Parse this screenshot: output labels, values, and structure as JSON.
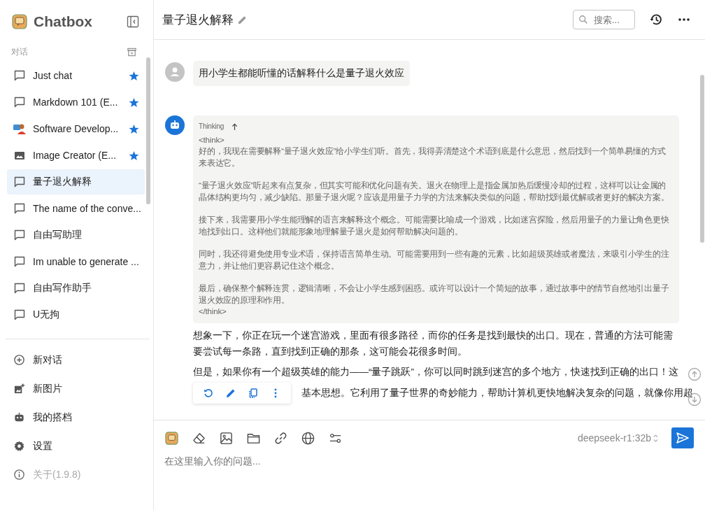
{
  "sidebar": {
    "app_name": "Chatbox",
    "section_label": "对话",
    "conversations": [
      {
        "title": "Just chat",
        "kind": "chat",
        "starred": true,
        "selected": false
      },
      {
        "title": "Markdown 101 (E...",
        "kind": "chat",
        "starred": true,
        "selected": false
      },
      {
        "title": "Software Develop...",
        "kind": "avatar",
        "starred": true,
        "selected": false
      },
      {
        "title": "Image Creator (E...",
        "kind": "image",
        "starred": true,
        "selected": false
      },
      {
        "title": "量子退火解释",
        "kind": "chat",
        "starred": false,
        "selected": true
      },
      {
        "title": "The name of the conve...",
        "kind": "chat",
        "starred": false,
        "selected": false
      },
      {
        "title": "自由写助理",
        "kind": "chat",
        "starred": false,
        "selected": false
      },
      {
        "title": "Im unable to generate ...",
        "kind": "chat",
        "starred": false,
        "selected": false
      },
      {
        "title": "自由写作助手",
        "kind": "chat",
        "starred": false,
        "selected": false
      },
      {
        "title": "U无拘",
        "kind": "chat",
        "starred": false,
        "selected": false
      }
    ],
    "menu": [
      {
        "label": "新对话",
        "kind": "new-chat",
        "disabled": false
      },
      {
        "label": "新图片",
        "kind": "new-image",
        "disabled": false
      },
      {
        "label": "我的搭档",
        "kind": "partners",
        "disabled": false
      },
      {
        "label": "设置",
        "kind": "settings",
        "disabled": false
      },
      {
        "label": "关于(1.9.8)",
        "kind": "about",
        "disabled": true
      }
    ]
  },
  "header": {
    "title": "量子退火解释",
    "search": {
      "placeholder": "搜索..."
    }
  },
  "messages": {
    "user": "用小学生都能听懂的话解释什么是量子退火效应",
    "thinking": {
      "label": "Thinking",
      "open_tag": "<think>",
      "close_tag": "</think>",
      "paragraphs": [
        "好的，我现在需要解释“量子退火效应”给小学生们听。首先，我得弄清楚这个术语到底是什么意思，然后找到一个简单易懂的方式来表达它。",
        "“量子退火效应”听起来有点复杂，但其实可能和优化问题有关。退火在物理上是指金属加热后缓慢冷却的过程，这样可以让金属的晶体结构更均匀，减少缺陷。那量子退火呢？应该是用量子力学的方法来解决类似的问题，帮助找到最优解或者更好的解决方案。",
        "接下来，我需要用小学生能理解的语言来解释这个概念。可能需要比喻成一个游戏，比如迷宫探险，然后用量子的力量让角色更快地找到出口。这样他们就能形象地理解量子退火是如何帮助解决问题的。",
        "同时，我还得避免使用专业术语，保持语言简单生动。可能需要用到一些有趣的元素，比如超级英雄或者魔法，来吸引小学生的注意力，并让他们更容易记住这个概念。",
        "最后，确保整个解释连贯，逻辑清晰，不会让小学生感到困惑。或许可以设计一个简短的故事，通过故事中的情节自然地引出量子退火效应的原理和作用。"
      ]
    },
    "answer": [
      "想象一下，你正在玩一个迷宫游戏，里面有很多路径，而你的任务是找到最快的出口。现在，普通的方法可能需要尝试每一条路，直到找到正确的那条，这可能会花很多时间。",
      "但是，如果你有一个超级英雄的能力——“量子跳跃”，你可以同时跳到迷宫的多个地方，快速找到正确的出口！这"
    ],
    "answer_partial": "基本思想。它利用了量子世界的奇妙能力，帮助计算机更快地解决复杂的问题，就像你用超"
  },
  "input": {
    "model": "deepseek-r1:32b",
    "placeholder": "在这里输入你的问题..."
  }
}
